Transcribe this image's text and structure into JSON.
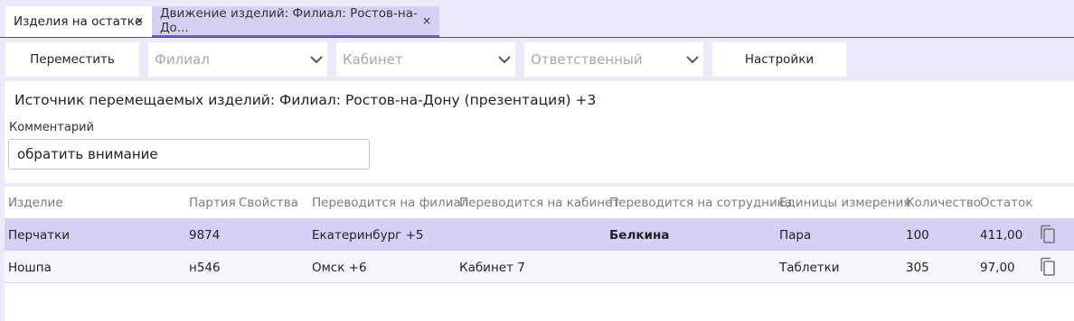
{
  "tabs": [
    {
      "label": "Изделия на остатке",
      "close": "×"
    },
    {
      "label": "Движение изделий: Филиал: Ростов-на-До...",
      "close": "×"
    }
  ],
  "toolbar": {
    "move_label": "Переместить",
    "branch_placeholder": "Филиал",
    "office_placeholder": "Кабинет",
    "responsible_placeholder": "Ответственный",
    "settings_label": "Настройки"
  },
  "source": {
    "text": "Источник перемещаемых изделий: Филиал: Ростов-на-Дону (презентация) +3",
    "comment_label": "Комментарий",
    "comment_value": "обратить внимание"
  },
  "table": {
    "columns": [
      "Изделие",
      "Партия",
      "Свойства",
      "Переводится на филиал",
      "Переводится на кабинет",
      "Переводится на сотрудника",
      "Единицы измерения",
      "Количество",
      "Остаток"
    ],
    "rows": [
      {
        "item": "Перчатки",
        "batch": "9874",
        "props": "",
        "branch": "Екатеринбург +5",
        "office": "",
        "employee": "Белкина",
        "unit": "Пара",
        "qty": "100",
        "rest": "411,00",
        "selected": true
      },
      {
        "item": "Ношпа",
        "batch": "н546",
        "props": "",
        "branch": "Омск +6",
        "office": "Кабинет 7",
        "employee": "",
        "unit": "Таблетки",
        "qty": "305",
        "rest": "97,00",
        "selected": false
      }
    ]
  },
  "colors": {
    "background": "#ebeafa",
    "selected_row": "#d6d1f4",
    "tab_accent": "#6c5ec9"
  },
  "icons": {
    "tab_close": "close-icon",
    "dropdown": "chevron-down-icon",
    "row_action": "copy-icon"
  }
}
